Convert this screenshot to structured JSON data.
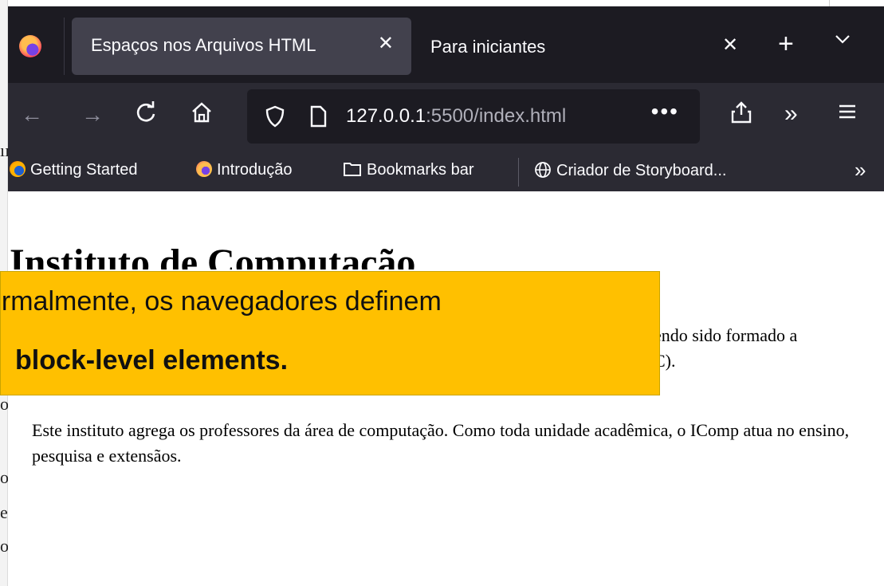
{
  "background": {
    "left_fragments": [
      "ıı",
      "ol",
      "o",
      "e",
      "o"
    ]
  },
  "browser": {
    "tabs": [
      {
        "title": "Espaços nos Arquivos HTML",
        "active": true
      },
      {
        "title": "Para iniciantes",
        "active": false
      }
    ],
    "url": {
      "host": "127.0.0.1",
      "rest": ":5500/index.html"
    },
    "bookmarks": [
      {
        "label": "Getting Started",
        "icon": "firefox-icon"
      },
      {
        "label": "Introdução",
        "icon": "firefox-icon"
      },
      {
        "label": "Bookmarks bar",
        "icon": "folder-icon"
      },
      {
        "label": "Criador de Storyboard...",
        "icon": "globe-icon"
      }
    ]
  },
  "page": {
    "heading": "Instituto de Computação",
    "para1_line1": "endo sido formado a",
    "para1_line2": "C).",
    "para2": "Este instituto agrega os professores da área de computação. Como toda unidade acadêmica, o IComp atua no ensino, pesquisa e extensãos."
  },
  "callout": {
    "line1": "ormalmente, os navegadores definem",
    "line2": "block-level elements."
  },
  "colors": {
    "tabbar_bg": "#1c1b22",
    "navbar_bg": "#2b2a33",
    "active_tab_bg": "#42414d",
    "callout_bg": "#ffc000"
  }
}
